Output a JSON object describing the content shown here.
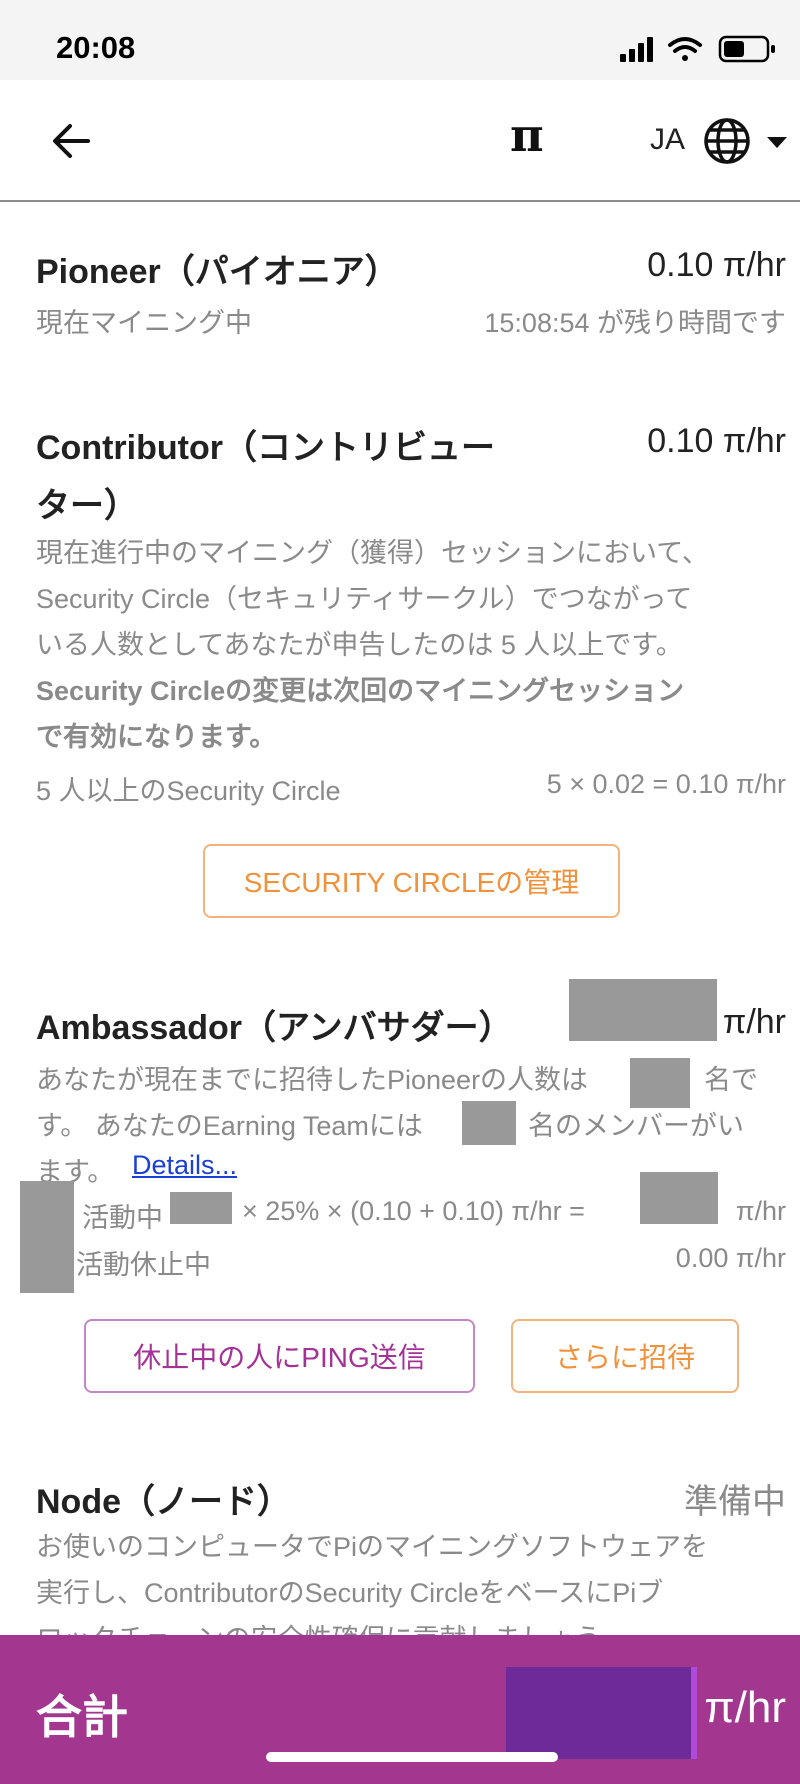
{
  "status": {
    "time": "20:08"
  },
  "appbar": {
    "logo": "π",
    "lang": "JA"
  },
  "pioneer": {
    "title": "Pioneer（パイオニア）",
    "rate": "0.10 π/hr",
    "status": "現在マイニング中",
    "remaining": "15:08:54 が残り時間です"
  },
  "contributor": {
    "title_line1": "Contributor（コントリビュー",
    "title_line2": "ター）",
    "rate": "0.10 π/hr",
    "para_l1": "現在進行中のマイニング（獲得）セッションにおいて、",
    "para_l2": "Security Circle（セキュリティサークル）でつながって",
    "para_l3": "いる人数としてあなたが申告したのは 5 人以上です。",
    "bold_l1": "Security Circleの変更は次回のマイニングセッション",
    "bold_l2": "で有効になります。",
    "calc_label": "5 人以上のSecurity Circle",
    "calc_value": "5 × 0.02 = 0.10 π/hr",
    "button": "SECURITY CIRCLEの管理"
  },
  "ambassador": {
    "title": "Ambassador（アンバサダー）",
    "rate_unit": "π/hr",
    "l1a": "あなたが現在までに招待したPioneerの人数は",
    "l1b": "名で",
    "l2a": "す。 あなたのEarning Teamには",
    "l2b": "名のメンバーがい",
    "l3a": "ます。",
    "details": "Details...",
    "active_label": "活動中",
    "active_formula": "× 25% × (0.10 + 0.10) π/hr =",
    "active_unit": "π/hr",
    "inactive_label": "活動休止中",
    "inactive_value": "0.00 π/hr",
    "ping_button": "休止中の人にPING送信",
    "invite_button": "さらに招待"
  },
  "node": {
    "title": "Node（ノード）",
    "status": "準備中",
    "para_l1": "お使いのコンピュータでPiのマイニングソフトウェアを",
    "para_l2": "実行し、ContributorのSecurity CircleをベースにPiブ",
    "para_l3": "ロックチェーンの安全性確保に貢献しましょう"
  },
  "footer": {
    "label": "合計",
    "unit": "π/hr"
  },
  "colors": {
    "accent": "#a3378f",
    "orange": "#f0913c",
    "redacted": "#999999"
  }
}
